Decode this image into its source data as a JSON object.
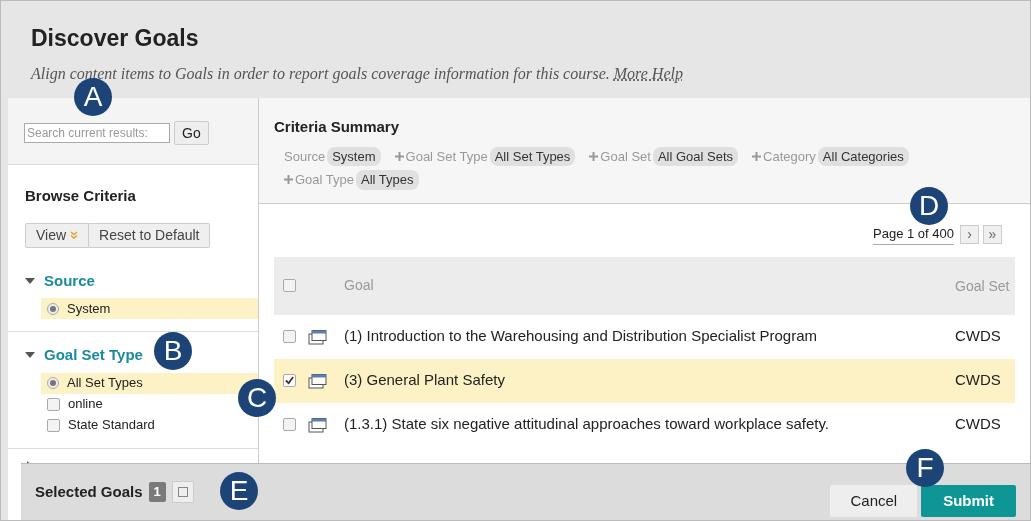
{
  "header": {
    "title": "Discover Goals",
    "subtitle": "Align content items to Goals in order to report goals coverage information for this course.",
    "help_link": "More Help"
  },
  "search": {
    "placeholder": "Search current results:",
    "button": "Go"
  },
  "browse": {
    "title": "Browse Criteria",
    "view_button": "View",
    "reset_button": "Reset to Default",
    "sections": [
      {
        "title": "Source",
        "expanded": true,
        "options": [
          {
            "kind": "radio",
            "label": "System",
            "selected": true
          }
        ]
      },
      {
        "title": "Goal Set Type",
        "expanded": true,
        "options": [
          {
            "kind": "radio",
            "label": "All Set Types",
            "selected": true
          },
          {
            "kind": "checkbox",
            "label": "online",
            "selected": false
          },
          {
            "kind": "checkbox",
            "label": "State Standard",
            "selected": false
          }
        ]
      },
      {
        "expanded": false
      }
    ]
  },
  "summary": {
    "title": "Criteria Summary",
    "filters": [
      {
        "label": "Source",
        "value": "System",
        "plus": false
      },
      {
        "label": "Goal Set Type",
        "value": "All Set Types",
        "plus": true
      },
      {
        "label": "Goal Set",
        "value": "All Goal Sets",
        "plus": true
      },
      {
        "label": "Category",
        "value": "All Categories",
        "plus": true
      },
      {
        "label": "Goal Type",
        "value": "All Types",
        "plus": true
      }
    ]
  },
  "pagination": {
    "text": "Page 1 of 400",
    "next": "›",
    "last": "»"
  },
  "table": {
    "columns": [
      "Goal",
      "Goal Set"
    ],
    "all_checked": false,
    "rows": [
      {
        "goal": "(1) Introduction to the Warehousing and Distribution Specialist Program",
        "goal_set": "CWDS",
        "checked": false
      },
      {
        "goal": "(3) General Plant Safety",
        "goal_set": "CWDS",
        "checked": true
      },
      {
        "goal": "(1.3.1) State six negative attitudinal approaches toward workplace safety.",
        "goal_set": "CWDS",
        "checked": false
      }
    ]
  },
  "footer": {
    "label": "Selected Goals",
    "count": "1",
    "cancel": "Cancel",
    "submit": "Submit"
  },
  "callouts": [
    "A",
    "B",
    "C",
    "D",
    "E",
    "F"
  ]
}
